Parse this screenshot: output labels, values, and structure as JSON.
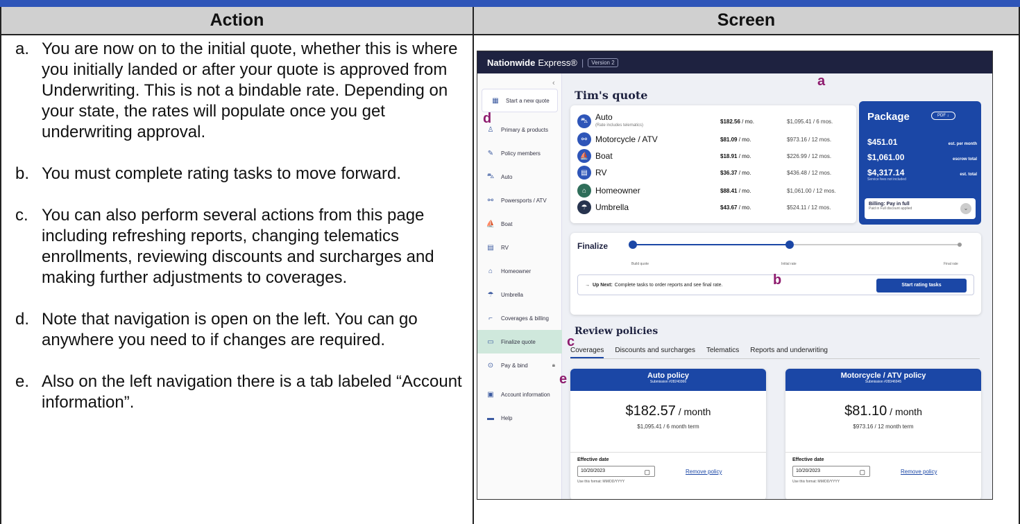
{
  "table": {
    "col_action": "Action",
    "col_screen": "Screen"
  },
  "steps": [
    {
      "letter": "a.",
      "text": "You are now on to the initial quote, whether this is where you initially landed or after your quote is approved from Underwriting. This is not a bindable rate. Depending on your state, the rates will populate once you get underwriting approval."
    },
    {
      "letter": "b.",
      "text": "You must complete rating tasks to move forward."
    },
    {
      "letter": "c.",
      "text": "You can also perform several actions from this page including refreshing reports, changing telematics enrollments, reviewing discounts and surcharges and making further adjustments to coverages."
    },
    {
      "letter": "d.",
      "text": "Note that navigation is open on the left. You can go anywhere you need to if changes are required."
    },
    {
      "letter": "e.",
      "text": "Also on the left navigation there is a tab labeled “Account information”."
    }
  ],
  "app": {
    "brand": "Nationwide",
    "brand_suffix": "Express®",
    "separator": "|",
    "version": "Version 2"
  },
  "sidenav": {
    "collapse": "‹",
    "start_quote": "Start a new quote",
    "items": [
      {
        "label": "Primary & products",
        "icon": "person-icon"
      },
      {
        "label": "Policy members",
        "icon": "pencil-icon"
      },
      {
        "label": "Auto",
        "icon": "car-icon"
      },
      {
        "label": "Powersports / ATV",
        "icon": "motorcycle-icon"
      },
      {
        "label": "Boat",
        "icon": "boat-icon"
      },
      {
        "label": "RV",
        "icon": "rv-icon"
      },
      {
        "label": "Homeowner",
        "icon": "home-icon"
      },
      {
        "label": "Umbrella",
        "icon": "umbrella-icon"
      },
      {
        "label": "Coverages & billing",
        "icon": "coverage-icon"
      },
      {
        "label": "Finalize quote",
        "icon": "folder-icon"
      },
      {
        "label": "Pay & bind",
        "icon": "check-circle-icon"
      },
      {
        "label": "Account information",
        "icon": "document-icon"
      },
      {
        "label": "Help",
        "icon": "chat-icon"
      }
    ]
  },
  "quote": {
    "title": "Tim's quote",
    "products": [
      {
        "name": "Auto",
        "sub": "(Rate includes telematics)",
        "monthly": "$182.56",
        "per": " / mo.",
        "term": "$1,095.41 / 6 mos."
      },
      {
        "name": "Motorcycle / ATV",
        "sub": "",
        "monthly": "$81.09",
        "per": " / mo.",
        "term": "$973.16 / 12 mos."
      },
      {
        "name": "Boat",
        "sub": "",
        "monthly": "$18.91",
        "per": " / mo.",
        "term": "$226.99 / 12 mos."
      },
      {
        "name": "RV",
        "sub": "",
        "monthly": "$36.37",
        "per": " / mo.",
        "term": "$436.48 / 12 mos."
      },
      {
        "name": "Homeowner",
        "sub": "",
        "monthly": "$88.41",
        "per": " / mo.",
        "term": "$1,061.00 / 12 mos."
      },
      {
        "name": "Umbrella",
        "sub": "",
        "monthly": "$43.67",
        "per": " / mo.",
        "term": "$524.11 / 12 mos."
      }
    ]
  },
  "package": {
    "title": "Package",
    "pdf": "PDF ↓",
    "per_month_amount": "$451.01",
    "per_month_label": "est. per month",
    "escrow_amount": "$1,061.00",
    "escrow_label": "escrow total",
    "total_amount": "$4,317.14",
    "total_label": "est. total",
    "fee_note": "Service fees not included",
    "billing_title": "Billing: Pay in full",
    "billing_sub": "Paid in Full discount applied"
  },
  "finalize": {
    "title": "Finalize",
    "steps": [
      "Build quote",
      "Initial rate",
      "Final rate"
    ],
    "upnext_prefix": "→",
    "upnext_bold": "Up Next:",
    "upnext_text": "Complete tasks to order reports and see final rate.",
    "button": "Start rating tasks"
  },
  "review": {
    "title": "Review policies",
    "tabs": [
      "Coverages",
      "Discounts and surcharges",
      "Telematics",
      "Reports and underwriting"
    ]
  },
  "policies": [
    {
      "title": "Auto policy",
      "submission": "Submission #28240366",
      "amount": "$182.57",
      "unit": " / month",
      "term": "$1,095.41 / 6 month term",
      "eff_label": "Effective date",
      "date": "10/20/2023",
      "format": "Use this format: MM/DD/YYYY",
      "remove": "Remove policy"
    },
    {
      "title": "Motorcycle / ATV policy",
      "submission": "Submission #28346945",
      "amount": "$81.10",
      "unit": " / month",
      "term": "$973.16  / 12 month term",
      "eff_label": "Effective date",
      "date": "10/20/2023",
      "format": "Use this format: MM/DD/YYYY",
      "remove": "Remove policy"
    }
  ],
  "callouts": {
    "a": "a",
    "b": "b",
    "c": "c",
    "d": "d",
    "e": "e"
  }
}
